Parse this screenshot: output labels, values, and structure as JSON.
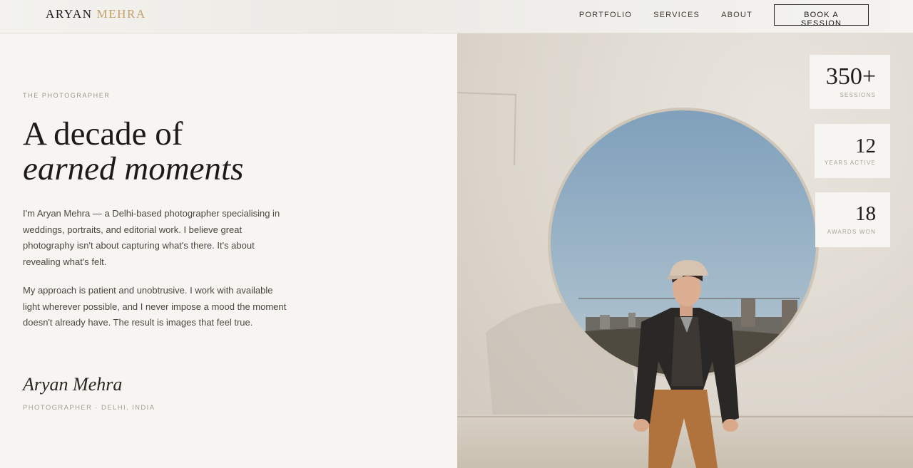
{
  "header": {
    "logo_first": "ARYAN",
    "logo_last": "MEHRA",
    "nav": [
      "PORTFOLIO",
      "SERVICES",
      "ABOUT"
    ],
    "cta": "BOOK A SESSION"
  },
  "about": {
    "eyebrow": "THE PHOTOGRAPHER",
    "title_line1": "A decade of",
    "title_line2": "earned moments",
    "paragraph1": "I'm Aryan Mehra — a Delhi-based photographer specialising in weddings, portraits, and editorial work. I believe great photography isn't about capturing what's there. It's about revealing what's felt.",
    "paragraph2": "My approach is patient and unobtrusive. I work with available light wherever possible, and I never impose a mood the moment doesn't already have. The result is images that feel true.",
    "signature": "Aryan Mehra",
    "signature_subtitle": "PHOTOGRAPHER · DELHI, INDIA"
  },
  "stats": [
    {
      "value": "350+",
      "label": "SESSIONS"
    },
    {
      "value": "12",
      "label": "YEARS ACTIVE"
    },
    {
      "value": "18",
      "label": "AWARDS WON"
    }
  ],
  "colors": {
    "accent": "#c6a066",
    "background": "#f6f5f1",
    "text": "#1d1a17"
  }
}
